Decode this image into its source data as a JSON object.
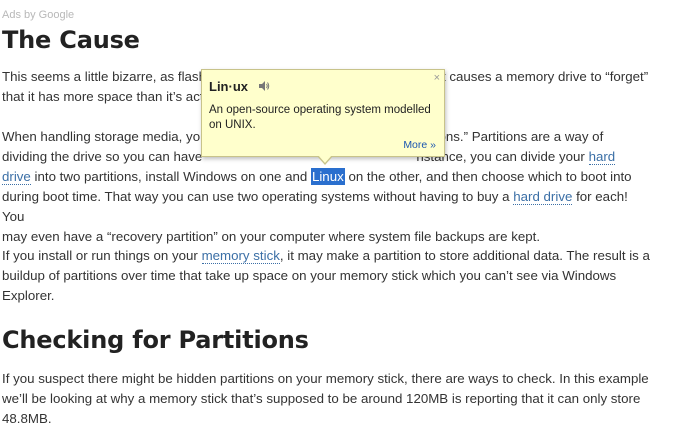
{
  "ads": {
    "label": "Ads by Google"
  },
  "section1": {
    "title": "The Cause",
    "para1": {
      "line1_a": "This seems a little bizarre, as flash",
      "line1_b": "t causes a memory drive to “forget”",
      "line2_a": "that it has more space than it’s act"
    },
    "para2": {
      "line1_a": "When handling storage media, you",
      "line1_b": "ions.” Partitions are a way of",
      "line2_a": "dividing the drive so you can have",
      "line2_b": "nstance, you can divide your ",
      "link_hard": "hard",
      "link_drive": "drive",
      "line3_a": " into two partitions, install Windows on one and ",
      "highlight": "Linux",
      "line3_b": " on the other, and then choose which to boot into",
      "line4": "during boot time. That way you can use two operating systems without having to buy a ",
      "link_hard_drive": "hard drive",
      "line4_b": " for each! You",
      "line5": "may even have a “recovery partition” on your computer where system file backups are kept."
    },
    "para3": {
      "line1_a": "If you install or run things on your ",
      "link_memory_stick": "memory stick",
      "line1_b": ", it may make a partition to store additional data. The result is a",
      "line2": "buildup of partitions over time that take up space on your memory stick which you can’t see via Windows",
      "line3": "Explorer."
    }
  },
  "section2": {
    "title": "Checking for Partitions",
    "para1": {
      "line1": "If you suspect there might be hidden partitions on your memory stick, there are ways to check. In this example",
      "line2": "we’ll be looking at why a memory stick that’s supposed to be around 120MB is reporting that it can only store",
      "line3": "48.8MB."
    }
  },
  "dictionary_popup": {
    "word": "Lin·ux",
    "close": "×",
    "definition": "An open-source operating system modelled on UNIX.",
    "more": "More »"
  },
  "colors": {
    "link": "#3b6fa6",
    "highlight": "#2a6fce",
    "popup_bg": "#ffffcc"
  }
}
